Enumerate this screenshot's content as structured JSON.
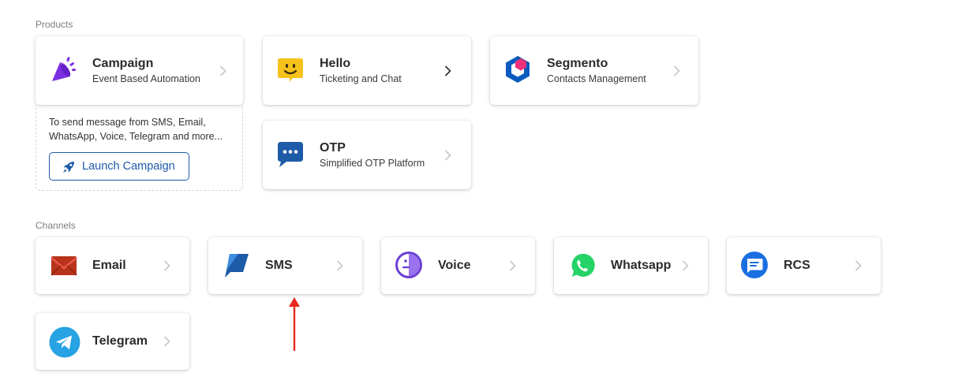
{
  "sections": {
    "products_title": "Products",
    "channels_title": "Channels"
  },
  "products": {
    "campaign": {
      "title": "Campaign",
      "subtitle": "Event Based Automation",
      "icon": "megaphone-icon"
    },
    "hello": {
      "title": "Hello",
      "subtitle": "Ticketing and Chat",
      "icon": "smiley-chat-icon"
    },
    "segmento": {
      "title": "Segmento",
      "subtitle": "Contacts Management",
      "icon": "hexagon-cube-icon"
    },
    "otp": {
      "title": "OTP",
      "subtitle": "Simplified OTP Platform",
      "icon": "chat-dots-icon"
    }
  },
  "campaign_panel": {
    "description": "To send message from SMS, Email, WhatsApp, Voice, Telegram and more...",
    "button_label": "Launch Campaign",
    "button_icon": "rocket-icon"
  },
  "channels": {
    "email": {
      "title": "Email",
      "icon": "envelope-icon"
    },
    "sms": {
      "title": "SMS",
      "icon": "sms-bubble-icon"
    },
    "voice": {
      "title": "Voice",
      "icon": "voice-face-icon"
    },
    "whatsapp": {
      "title": "Whatsapp",
      "icon": "whatsapp-icon"
    },
    "rcs": {
      "title": "RCS",
      "icon": "rcs-message-icon"
    },
    "telegram": {
      "title": "Telegram",
      "icon": "telegram-icon"
    }
  },
  "colors": {
    "accent_blue": "#1d5aa7",
    "annotation_arrow": "#e8281f",
    "campaign_purple": "#7b2fe0",
    "hello_yellow": "#f6c21c",
    "segmento_blue": "#0b5bbf",
    "segmento_pink": "#f0307a",
    "whatsapp_green": "#25d366",
    "rcs_blue": "#1a6fe0",
    "telegram_blue": "#27a3e3",
    "email_red": "#b7341b"
  }
}
